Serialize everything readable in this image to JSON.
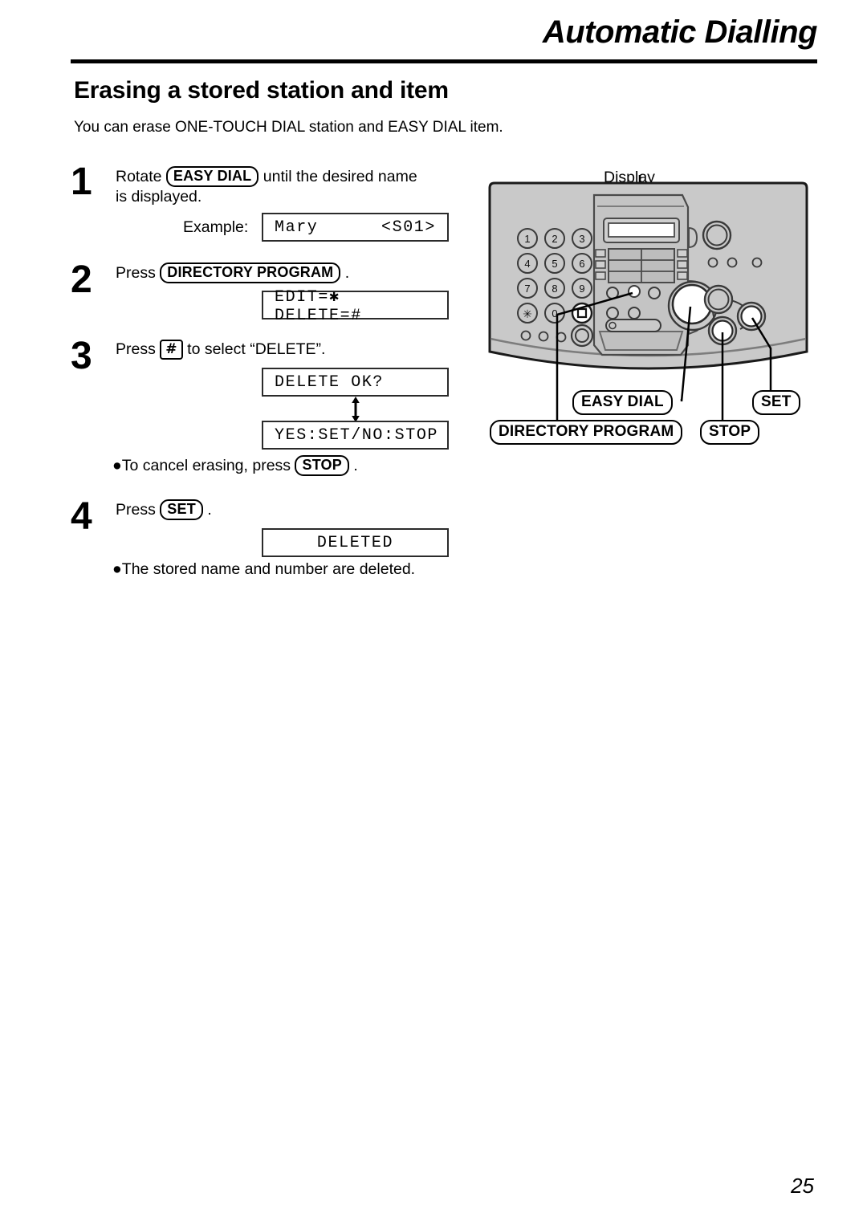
{
  "header": {
    "chapter_title": "Automatic Dialling",
    "section_title": "Erasing a stored station and item",
    "intro": "You can erase ONE-TOUCH DIAL station and EASY DIAL item."
  },
  "steps": [
    {
      "number": "1",
      "text_before": "Rotate",
      "key": "EASY DIAL",
      "text_after": "until the desired name",
      "text_line2": "is displayed.",
      "example_label": "Example:",
      "lcd_left": "Mary",
      "lcd_right": "<S01>"
    },
    {
      "number": "2",
      "text_before": "Press",
      "key": "DIRECTORY PROGRAM",
      "text_after": ".",
      "lcd": "EDIT=✱ DELETE=#"
    },
    {
      "number": "3",
      "text_before": "Press",
      "key": "#",
      "text_after": "to select “DELETE”.",
      "lcd_first": "DELETE OK?",
      "lcd_second": "YES:SET/NO:STOP",
      "note_before": "●To cancel erasing, press",
      "note_key": "STOP",
      "note_after": "."
    },
    {
      "number": "4",
      "text_before": "Press",
      "key": "SET",
      "text_after": ".",
      "lcd": "DELETED",
      "note": "●The stored name and number are deleted."
    }
  ],
  "diagram": {
    "display_label": "Display",
    "keypad": [
      "1",
      "2",
      "3",
      "4",
      "5",
      "6",
      "7",
      "8",
      "9",
      "✱",
      "0",
      "#"
    ],
    "callouts": [
      {
        "label": "EASY DIAL"
      },
      {
        "label": "SET"
      },
      {
        "label": "DIRECTORY PROGRAM"
      },
      {
        "label": "STOP"
      }
    ],
    "body_color": "#c9c9c9",
    "outline_color": "#1a1a1a"
  },
  "footer": {
    "page_number": "25"
  }
}
